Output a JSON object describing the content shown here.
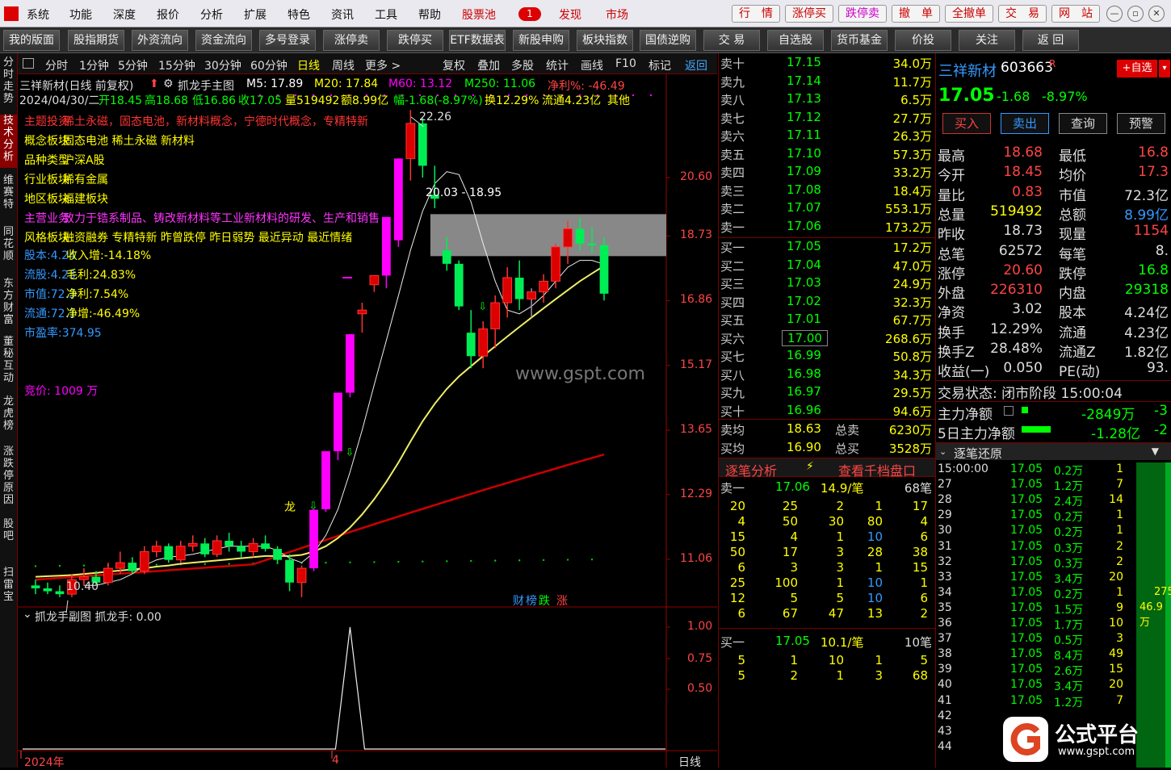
{
  "menu": {
    "items": [
      "系统",
      "功能",
      "深度",
      "报价",
      "分析",
      "扩展",
      "特色",
      "资讯",
      "工具",
      "帮助"
    ],
    "pool_label": "股票池",
    "pool_count": "1",
    "right_buttons": [
      "发现",
      "市场"
    ],
    "quick_buttons": [
      "行　情",
      "涨停买",
      "跌停卖",
      "撤　单",
      "全撤单",
      "交　易",
      "网　站"
    ]
  },
  "toolbar": {
    "items": [
      "我的版面",
      "股指期货",
      "外资流向",
      "资金流向",
      "多号登录",
      "涨停卖",
      "跌停买",
      "ETF数据表",
      "新股申购",
      "板块指数",
      "国债逆购",
      "交 易",
      "自选股",
      "货币基金",
      "价投",
      "关注",
      "返 回"
    ]
  },
  "left_tabs": [
    "分时走势",
    "技术分析",
    "维赛特",
    "同花顺",
    "东方财富",
    "董秘互动",
    "龙虎榜",
    "涨跌停原因",
    "股吧",
    "扫雷宝"
  ],
  "chart_menu": [
    "分时",
    "1分钟",
    "5分钟",
    "15分钟",
    "30分钟",
    "60分钟",
    "日线",
    "周线",
    "更多 >",
    "复权",
    "叠加",
    "多股",
    "统计",
    "画线",
    "F10",
    "标记",
    "返回"
  ],
  "chart": {
    "header1": {
      "stock": "三祥新材(日线 前复权)",
      "indicator": "抓龙手主图",
      "m5": "M5: 17.89",
      "m20": "M20: 17.84",
      "m60": "M60: 13.12",
      "m250": "M250: 11.06",
      "jl": "净利%: -46.49"
    },
    "header2": {
      "date": "2024/04/30/二",
      "open": "开18.45",
      "high": "高18.68",
      "low": "低16.86",
      "close": "收17.05",
      "vol": "量519492",
      "amt": "额8.99亿",
      "chg": "幅-1.68(-8.97%)",
      "turn": "换12.29%",
      "float": "流通4.23亿",
      "other": "其他"
    },
    "info_lines": [
      {
        "label": "主题投资",
        "value": "稀土永磁，固态电池，新材料概念，宁德时代概念，专精特新",
        "color": "#ff3333"
      },
      {
        "label": "概念板块",
        "value": "固态电池 稀土永磁 新材料",
        "color": "#ffff00"
      },
      {
        "label": "品种类型",
        "value": "沪深A股",
        "color": "#ffff00"
      },
      {
        "label": "行业板块",
        "value": "稀有金属",
        "color": "#ffff00"
      },
      {
        "label": "地区板块",
        "value": "福建板块",
        "color": "#ffff00"
      },
      {
        "label": "主营业务",
        "value": "致力于锆系制品、铸改新材料等工业新材料的研发、生产和销售",
        "color": "#ff33ff"
      },
      {
        "label": "风格板块",
        "value": "融资融券 专精特新 昨曾跌停 昨日弱势 最近异动 最近情绪",
        "color": "#ffff00"
      }
    ],
    "fin_lines": [
      {
        "a": "股本:4.24",
        "b": "收入增:-14.18%"
      },
      {
        "a": "流股:4.23",
        "b": "毛利:24.83%"
      },
      {
        "a": "市值:72.3",
        "b": "净利:7.54%"
      },
      {
        "a": "流通:72.1",
        "b": "净增:-46.49%"
      },
      {
        "a": "市盈率:374.95",
        "b": ""
      }
    ],
    "auction": "竞价: 1009 万",
    "price_axis": [
      "20.60",
      "18.73",
      "16.86",
      "15.17",
      "13.65",
      "12.29",
      "11.06"
    ],
    "high_label": "22.26",
    "low_label": "10.40",
    "gap_label": "20.03 - 18.95",
    "dragon_label": "龙",
    "watermark": "www.gspt.com",
    "badge_cai": "财",
    "badge_bang": "榜",
    "badge_die": "跌",
    "badge_zhang": "涨",
    "sub_title": "抓龙手副图 抓龙手: 0.00",
    "sub_axis": [
      "1.00",
      "0.75",
      "0.50"
    ],
    "date_year": "2024年",
    "date_month": "4",
    "period_label": "日线"
  },
  "chart_data": {
    "type": "candlestick",
    "candles": [
      [
        10.6,
        10.7,
        10.45,
        10.55
      ],
      [
        10.55,
        10.65,
        10.45,
        10.5
      ],
      [
        10.5,
        10.6,
        10.4,
        10.45
      ],
      [
        10.45,
        10.8,
        10.4,
        10.7
      ],
      [
        10.7,
        10.9,
        10.6,
        10.75
      ],
      [
        10.75,
        10.85,
        10.6,
        10.65
      ],
      [
        10.65,
        11.0,
        10.6,
        10.9
      ],
      [
        10.9,
        11.2,
        10.8,
        11.0
      ],
      [
        11.0,
        11.1,
        10.8,
        10.85
      ],
      [
        10.85,
        11.3,
        10.8,
        11.2
      ],
      [
        11.2,
        11.4,
        11.1,
        11.3
      ],
      [
        11.3,
        11.35,
        11.0,
        11.05
      ],
      [
        11.05,
        11.4,
        11.0,
        11.3
      ],
      [
        11.3,
        11.5,
        11.2,
        11.35
      ],
      [
        11.35,
        11.45,
        11.1,
        11.15
      ],
      [
        11.15,
        11.5,
        11.1,
        11.4
      ],
      [
        11.4,
        11.55,
        11.2,
        11.3
      ],
      [
        11.3,
        11.4,
        11.1,
        11.2
      ],
      [
        11.2,
        11.45,
        11.1,
        11.35
      ],
      [
        11.35,
        11.5,
        11.2,
        11.25
      ],
      [
        11.25,
        11.3,
        11.0,
        11.05
      ],
      [
        11.05,
        11.15,
        10.5,
        10.65
      ],
      [
        10.65,
        10.95,
        10.4,
        10.9
      ],
      [
        10.9,
        12.0,
        10.85,
        11.99
      ],
      [
        12.0,
        13.19,
        11.95,
        13.19
      ],
      [
        13.19,
        14.5,
        13.0,
        14.51
      ],
      [
        14.51,
        15.96,
        14.4,
        15.96
      ],
      [
        16.5,
        16.8,
        16.0,
        16.6
      ],
      [
        17.3,
        17.56,
        17.1,
        17.56
      ],
      [
        17.56,
        19.32,
        17.2,
        19.32
      ],
      [
        18.6,
        21.25,
        18.4,
        21.25
      ],
      [
        21.25,
        23.0,
        20.5,
        22.5
      ],
      [
        22.5,
        22.7,
        20.6,
        21.0
      ],
      [
        20.03,
        21.0,
        19.6,
        19.9
      ],
      [
        18.3,
        18.7,
        17.7,
        17.9
      ],
      [
        17.9,
        18.0,
        16.6,
        16.7
      ],
      [
        16.0,
        16.6,
        15.1,
        15.4
      ],
      [
        15.4,
        16.3,
        15.1,
        16.1
      ],
      [
        16.1,
        17.0,
        15.6,
        16.8
      ],
      [
        16.8,
        17.8,
        16.4,
        17.5
      ],
      [
        17.5,
        18.0,
        16.6,
        16.9
      ],
      [
        16.9,
        17.2,
        16.4,
        17.1
      ],
      [
        17.1,
        17.6,
        16.8,
        17.4
      ],
      [
        17.4,
        18.5,
        17.2,
        18.4
      ],
      [
        18.4,
        19.2,
        17.9,
        18.95
      ],
      [
        18.95,
        19.3,
        18.3,
        18.5
      ],
      [
        18.5,
        19.0,
        18.2,
        18.45
      ],
      [
        18.45,
        18.68,
        16.86,
        17.05
      ]
    ],
    "ma20": [
      10.75,
      10.76,
      10.77,
      10.78,
      10.8,
      10.82,
      10.84,
      10.86,
      10.88,
      10.9,
      10.93,
      10.95,
      10.98,
      11.0,
      11.02,
      11.04,
      11.06,
      11.08,
      11.1,
      11.12,
      11.12,
      11.12,
      11.14,
      11.2,
      11.3,
      11.45,
      11.65,
      11.9,
      12.2,
      12.55,
      12.95,
      13.4,
      13.85,
      14.25,
      14.6,
      14.9,
      15.15,
      15.4,
      15.65,
      15.9,
      16.15,
      16.4,
      16.65,
      16.9,
      17.15,
      17.4,
      17.62,
      17.84
    ],
    "ma5": [
      null,
      null,
      null,
      null,
      10.6,
      10.6,
      10.65,
      10.7,
      10.8,
      10.95,
      11.05,
      11.1,
      11.12,
      11.15,
      11.2,
      11.25,
      11.3,
      11.3,
      11.3,
      11.3,
      11.22,
      11.08,
      11.0,
      11.18,
      11.5,
      12.0,
      12.75,
      13.65,
      14.7,
      15.8,
      17.0,
      18.3,
      19.5,
      20.4,
      20.8,
      20.7,
      19.8,
      18.5,
      17.4,
      16.6,
      16.5,
      16.7,
      17.0,
      17.4,
      17.8,
      18.0,
      18.0,
      17.89
    ],
    "ma60_tail": [
      12.6,
      12.65,
      12.7,
      12.76,
      12.82,
      12.88,
      12.94,
      13.0,
      13.06,
      13.12
    ],
    "ma250_level": 11.06,
    "price_axis_ticks": [
      20.6,
      18.73,
      16.86,
      15.17,
      13.65,
      12.29,
      11.06
    ],
    "sub_indicator": {
      "peak_index": 26,
      "value": 0.0,
      "ticks": [
        1.0,
        0.75,
        0.5
      ]
    }
  },
  "orderbook": {
    "asks": [
      {
        "label": "卖十",
        "price": "17.15",
        "vol": "34.0万"
      },
      {
        "label": "卖九",
        "price": "17.14",
        "vol": "11.7万"
      },
      {
        "label": "卖八",
        "price": "17.13",
        "vol": "6.5万"
      },
      {
        "label": "卖七",
        "price": "17.12",
        "vol": "27.7万"
      },
      {
        "label": "卖六",
        "price": "17.11",
        "vol": "26.3万"
      },
      {
        "label": "卖五",
        "price": "17.10",
        "vol": "57.3万"
      },
      {
        "label": "卖四",
        "price": "17.09",
        "vol": "33.2万"
      },
      {
        "label": "卖三",
        "price": "17.08",
        "vol": "18.4万"
      },
      {
        "label": "卖二",
        "price": "17.07",
        "vol": "553.1万"
      },
      {
        "label": "卖一",
        "price": "17.06",
        "vol": "173.2万"
      }
    ],
    "bids": [
      {
        "label": "买一",
        "price": "17.05",
        "vol": "17.2万"
      },
      {
        "label": "买二",
        "price": "17.04",
        "vol": "47.0万"
      },
      {
        "label": "买三",
        "price": "17.03",
        "vol": "24.9万"
      },
      {
        "label": "买四",
        "price": "17.02",
        "vol": "32.3万"
      },
      {
        "label": "买五",
        "price": "17.01",
        "vol": "67.7万"
      },
      {
        "label": "买六",
        "price": "17.00",
        "vol": "268.6万"
      },
      {
        "label": "买七",
        "price": "16.99",
        "vol": "50.8万"
      },
      {
        "label": "买八",
        "price": "16.98",
        "vol": "34.3万"
      },
      {
        "label": "买九",
        "price": "16.97",
        "vol": "29.5万"
      },
      {
        "label": "买十",
        "price": "16.96",
        "vol": "94.6万"
      }
    ],
    "sell_avg_label": "卖均",
    "sell_avg": "18.63",
    "sell_total_label": "总卖",
    "sell_total": "6230万",
    "buy_avg_label": "买均",
    "buy_avg": "16.90",
    "buy_total_label": "总买",
    "buy_total": "3528万",
    "tab_left": "逐笔分析",
    "tab_right": "查看千档盘口",
    "sell1_label": "卖一",
    "sell1_price": "17.06",
    "sell1_avg": "14.9/笔",
    "sell1_count": "68笔",
    "sell_queue": [
      [
        "20",
        "25",
        "2",
        "1",
        "17"
      ],
      [
        "4",
        "50",
        "30",
        "80",
        "4"
      ],
      [
        "15",
        "4",
        "1",
        "10",
        "6"
      ],
      [
        "50",
        "17",
        "3",
        "28",
        "38"
      ],
      [
        "6",
        "3",
        "3",
        "1",
        "15"
      ],
      [
        "25",
        "100",
        "1",
        "10",
        "1"
      ],
      [
        "12",
        "5",
        "5",
        "10",
        "6"
      ],
      [
        "6",
        "67",
        "47",
        "13",
        "2"
      ]
    ],
    "buy1_label": "买一",
    "buy1_price": "17.05",
    "buy1_avg": "10.1/笔",
    "buy1_count": "10笔",
    "buy_queue": [
      [
        "5",
        "1",
        "10",
        "1",
        "5"
      ],
      [
        "5",
        "2",
        "1",
        "3",
        "68"
      ]
    ]
  },
  "info": {
    "name": "三祥新材",
    "code": "603663",
    "r": "R",
    "add_btn": "+自选",
    "price": "17.05",
    "chg": "-1.68",
    "pct": "-8.97%",
    "btns": [
      "买入",
      "卖出",
      "查询",
      "预警"
    ],
    "rows": [
      {
        "a": "最高",
        "b": "18.68",
        "c": "最低",
        "d": "16.8"
      },
      {
        "a": "今开",
        "b": "18.45",
        "c": "均价",
        "d": "17.3"
      },
      {
        "a": "量比",
        "b": "0.83",
        "c": "市值",
        "d": "72.3亿"
      },
      {
        "a": "总量",
        "b": "519492",
        "c": "总额",
        "d": "8.99亿"
      },
      {
        "a": "昨收",
        "b": "18.73",
        "c": "现量",
        "d": "1154"
      },
      {
        "a": "总笔",
        "b": "62572",
        "c": "每笔",
        "d": "8."
      },
      {
        "a": "涨停",
        "b": "20.60",
        "c": "跌停",
        "d": "16.8"
      },
      {
        "a": "外盘",
        "b": "226310",
        "c": "内盘",
        "d": "29318"
      },
      {
        "a": "净资",
        "b": "3.02",
        "c": "股本",
        "d": "4.24亿"
      },
      {
        "a": "换手",
        "b": "12.29%",
        "c": "流通",
        "d": "4.23亿"
      },
      {
        "a": "换手Z",
        "b": "28.48%",
        "c": "流通Z",
        "d": "1.82亿"
      },
      {
        "a": "收益(一)",
        "b": "0.050",
        "c": "PE(动)",
        "d": "93."
      }
    ],
    "status": "交易状态: 闭市阶段 15:00:04",
    "main_net_label": "主力净额",
    "main_net": "-2849万",
    "main_net2": "-3",
    "net5_label": "5日主力净额",
    "net5": "-1.28亿",
    "net5_2": "-2",
    "ticks_title": "逐笔还原",
    "ticks": [
      {
        "t": "15:00:00",
        "p": "17.05",
        "v": "0.2万",
        "n": "1"
      },
      {
        "t": "27",
        "p": "17.05",
        "v": "1.2万",
        "n": "7"
      },
      {
        "t": "28",
        "p": "17.05",
        "v": "2.4万",
        "n": "14"
      },
      {
        "t": "29",
        "p": "17.05",
        "v": "0.2万",
        "n": "1"
      },
      {
        "t": "30",
        "p": "17.05",
        "v": "0.2万",
        "n": "1"
      },
      {
        "t": "31",
        "p": "17.05",
        "v": "0.3万",
        "n": "2"
      },
      {
        "t": "32",
        "p": "17.05",
        "v": "0.3万",
        "n": "2"
      },
      {
        "t": "33",
        "p": "17.05",
        "v": "3.4万",
        "n": "20"
      },
      {
        "t": "34",
        "p": "17.05",
        "v": "0.2万",
        "n": "1"
      },
      {
        "t": "35",
        "p": "17.05",
        "v": "1.5万",
        "n": "9"
      },
      {
        "t": "36",
        "p": "17.05",
        "v": "1.7万",
        "n": "10"
      },
      {
        "t": "37",
        "p": "17.05",
        "v": "0.5万",
        "n": "3"
      },
      {
        "t": "38",
        "p": "17.05",
        "v": "8.4万",
        "n": "49"
      },
      {
        "t": "39",
        "p": "17.05",
        "v": "2.6万",
        "n": "15"
      },
      {
        "t": "40",
        "p": "17.05",
        "v": "3.4万",
        "n": "20"
      },
      {
        "t": "41",
        "p": "17.05",
        "v": "1.2万",
        "n": "7"
      },
      {
        "t": "42",
        "p": "",
        "v": "",
        "n": ""
      },
      {
        "t": "43",
        "p": "",
        "v": "",
        "n": ""
      },
      {
        "t": "44",
        "p": "",
        "v": "",
        "n": ""
      }
    ],
    "side_val1": "275",
    "side_val2": "46.9万",
    "watermark_title": "公式平台",
    "watermark_url": "www.gspt.com"
  }
}
